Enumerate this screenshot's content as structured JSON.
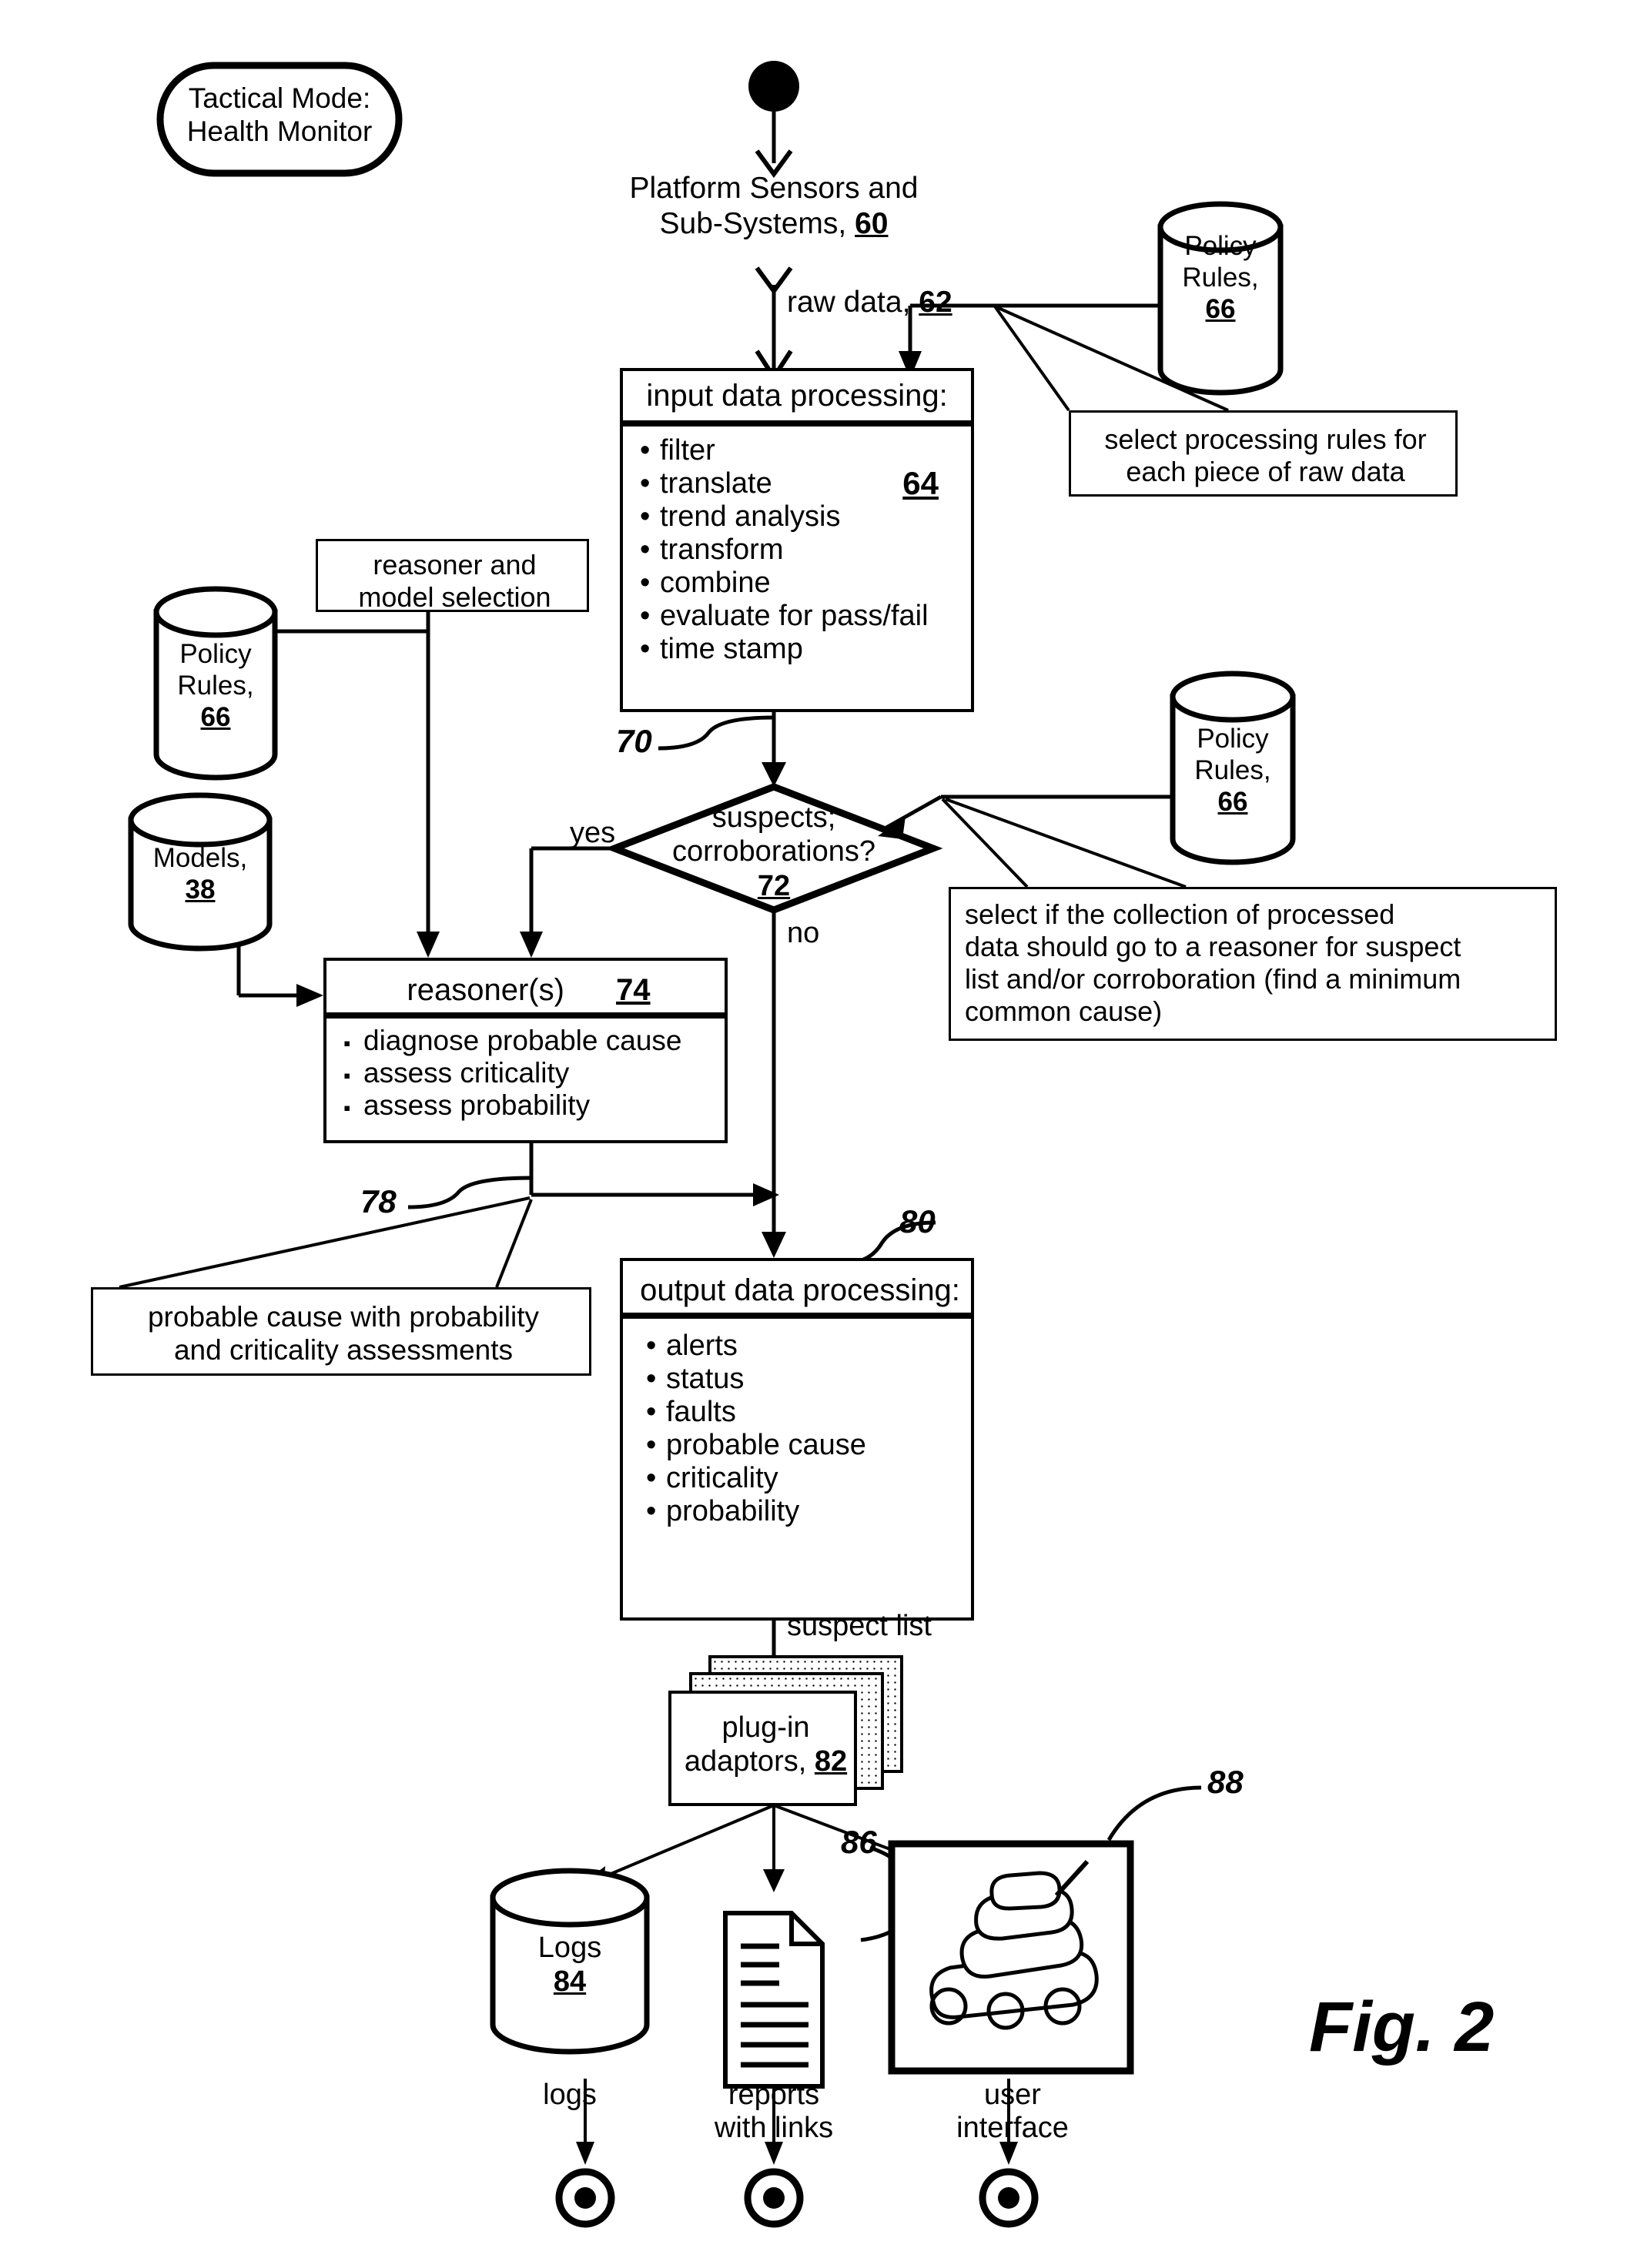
{
  "figure": {
    "label": "Fig. 2",
    "mode_badge": [
      "Tactical Mode:",
      "Health Monitor"
    ]
  },
  "flow": {
    "start_node": "start-dot",
    "source_label": [
      "Platform Sensors and",
      "Sub-Systems, 60"
    ],
    "source_text": "Platform Sensors and",
    "source_text2": "Sub-Systems,",
    "source_ref": "60",
    "raw_data_label": "raw data,",
    "raw_data_ref": "62",
    "ref_70": "70",
    "ref_78": "78",
    "ref_80": "80",
    "ref_86": "86",
    "ref_88": "88",
    "yes_label": "yes",
    "no_label": "no",
    "suspect_list_label": "suspect list"
  },
  "input_processing": {
    "title": "input data processing:",
    "ref": "64",
    "items": [
      "filter",
      "translate",
      "trend analysis",
      "transform",
      "combine",
      "evaluate for pass/fail",
      "time stamp"
    ]
  },
  "decision": {
    "line1": "suspects;",
    "line2": "corroborations?",
    "ref": "72"
  },
  "reasoner": {
    "title": "reasoner(s)",
    "ref": "74",
    "items": [
      "diagnose probable cause",
      "assess criticality",
      "assess probability"
    ]
  },
  "output_processing": {
    "title": "output data processing:",
    "items": [
      "alerts",
      "status",
      "faults",
      "probable cause",
      "criticality",
      "probability"
    ]
  },
  "adaptors": {
    "line1": "plug-in",
    "line2": "adaptors,",
    "ref": "82"
  },
  "datastores": {
    "policy_top": {
      "line1": "Policy",
      "line2": "Rules,",
      "ref": "66"
    },
    "policy_left": {
      "line1": "Policy",
      "line2": "Rules,",
      "ref": "66"
    },
    "policy_mid": {
      "line1": "Policy",
      "line2": "Rules,",
      "ref": "66"
    },
    "models": {
      "line1": "Models,",
      "ref": "38"
    },
    "logs": {
      "line1": "Logs",
      "ref": "84"
    }
  },
  "annotations": {
    "select_processing_rules": [
      "select processing rules for",
      "each piece of raw data"
    ],
    "reasoner_model_selection": [
      "reasoner and",
      "model selection"
    ],
    "select_if_collection": [
      "select if the collection of processed",
      "data should go to a reasoner for suspect",
      "list and/or corroboration (find a minimum",
      "common cause)"
    ],
    "probable_cause": [
      "probable cause with probability",
      "and criticality assessments"
    ]
  },
  "outputs": {
    "logs_caption": "logs",
    "reports_caption": [
      "reports",
      "with links"
    ],
    "ui_caption": [
      "user",
      "interface"
    ]
  },
  "colors": {
    "ink": "#000000",
    "paper": "#ffffff"
  }
}
